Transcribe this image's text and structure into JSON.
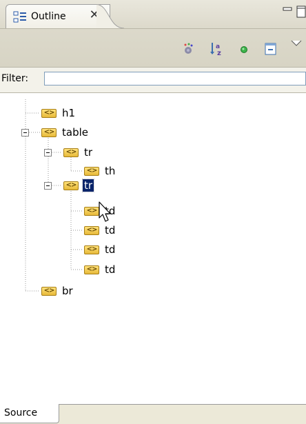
{
  "panel": {
    "tab_label": "Outline",
    "close_glyph": "✕"
  },
  "toolbar": {
    "icons": [
      "filter-members-icon",
      "sort-alphabetically-icon",
      "show-attributes-icon",
      "collapse-all-icon",
      "view-menu-icon"
    ],
    "sort_icon_text": "a z"
  },
  "filter": {
    "label": "Filter:",
    "value": "",
    "placeholder": ""
  },
  "tree": {
    "tag_icon_text": "<>",
    "nodes": [
      {
        "label": "h1",
        "depth": 0,
        "expandable": false,
        "selected": false
      },
      {
        "label": "table",
        "depth": 0,
        "expandable": true,
        "expanded": true,
        "selected": false
      },
      {
        "label": "tr",
        "depth": 1,
        "expandable": true,
        "expanded": true,
        "selected": false
      },
      {
        "label": "th",
        "depth": 2,
        "expandable": false,
        "selected": false
      },
      {
        "label": "tr",
        "depth": 1,
        "expandable": true,
        "expanded": true,
        "selected": true
      },
      {
        "label": "td",
        "depth": 2,
        "expandable": false,
        "selected": false
      },
      {
        "label": "td",
        "depth": 2,
        "expandable": false,
        "selected": false
      },
      {
        "label": "td",
        "depth": 2,
        "expandable": false,
        "selected": false
      },
      {
        "label": "td",
        "depth": 2,
        "expandable": false,
        "selected": false
      },
      {
        "label": "br",
        "depth": 0,
        "expandable": false,
        "selected": false
      }
    ]
  },
  "bottom_tabs": {
    "source_label": "Source"
  },
  "colors": {
    "selection": "#0a246a",
    "chrome": "#ece9d8",
    "tag_icon": "#e7b93a"
  }
}
